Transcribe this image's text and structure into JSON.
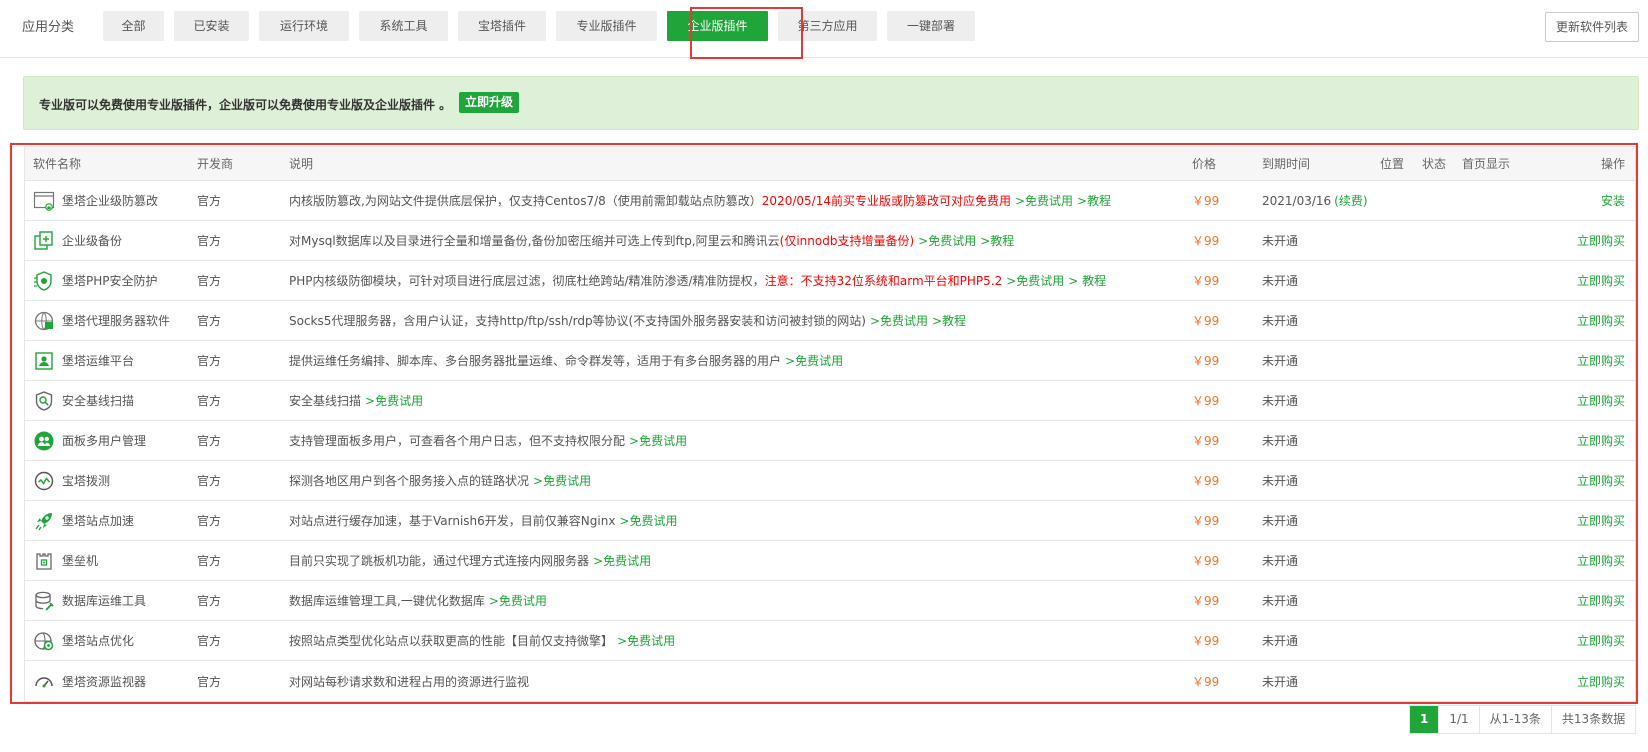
{
  "category": {
    "title": "应用分类",
    "tabs": [
      {
        "label": "全部"
      },
      {
        "label": "已安装"
      },
      {
        "label": "运行环境"
      },
      {
        "label": "系统工具"
      },
      {
        "label": "宝塔插件"
      },
      {
        "label": "专业版插件"
      },
      {
        "label": "企业版插件",
        "active": true
      },
      {
        "label": "第三方应用"
      },
      {
        "label": "一键部署"
      }
    ],
    "refresh_label": "更新软件列表"
  },
  "notice": {
    "text": "专业版可以免费使用专业版插件，企业版可以免费使用专业版及企业版插件 。",
    "upgrade_label": "立即升级"
  },
  "table": {
    "headers": {
      "name": "软件名称",
      "developer": "开发商",
      "desc": "说明",
      "price": "价格",
      "expire": "到期时间",
      "position": "位置",
      "status": "状态",
      "home": "首页显示",
      "action": "操作"
    },
    "rows": [
      {
        "icon": "tamper-proof-icon",
        "name": "堡塔企业级防篡改",
        "developer": "官方",
        "desc": "内核版防篡改,为网站文件提供底层保护，仅支持Centos7/8（使用前需卸载站点防篡改）",
        "desc_red": "2020/05/14前买专业版或防篡改可对应免费用",
        "links": [
          ">免费试用",
          ">教程"
        ],
        "price": "￥99",
        "expire": "2021/03/16",
        "expire_link": "(续费)",
        "action": "安装"
      },
      {
        "icon": "backup-icon",
        "name": "企业级备份",
        "developer": "官方",
        "desc": "对Mysql数据库以及目录进行全量和增量备份,备份加密压缩并可选上传到ftp,阿里云和腾讯云",
        "desc_red": "(仅innodb支持增量备份)",
        "links": [
          ">免费试用",
          ">教程"
        ],
        "price": "￥99",
        "expire": "未开通",
        "action": "立即购买"
      },
      {
        "icon": "php-shield-icon",
        "name": "堡塔PHP安全防护",
        "developer": "官方",
        "desc": "PHP内核级防御模块，可针对项目进行底层过滤，彻底杜绝跨站/精准防渗透/精准防提权，",
        "desc_red": "注意：不支持32位系统和arm平台和PHP5.2",
        "links": [
          ">免费试用",
          "> 教程"
        ],
        "price": "￥99",
        "expire": "未开通",
        "action": "立即购买"
      },
      {
        "icon": "proxy-server-icon",
        "name": "堡塔代理服务器软件",
        "developer": "官方",
        "desc": "Socks5代理服务器，含用户认证，支持http/ftp/ssh/rdp等协议(不支持国外服务器安装和访问被封锁的网站)",
        "desc_red": "",
        "links": [
          ">免费试用",
          ">教程"
        ],
        "price": "￥99",
        "expire": "未开通",
        "action": "立即购买"
      },
      {
        "icon": "ops-platform-icon",
        "name": "堡塔运维平台",
        "developer": "官方",
        "desc": "提供运维任务编排、脚本库、多台服务器批量运维、命令群发等，适用于有多台服务器的用户",
        "desc_red": "",
        "links": [
          ">免费试用"
        ],
        "price": "￥99",
        "expire": "未开通",
        "action": "立即购买"
      },
      {
        "icon": "baseline-scan-icon",
        "name": "安全基线扫描",
        "developer": "官方",
        "desc": "安全基线扫描",
        "desc_red": "",
        "links": [
          ">免费试用"
        ],
        "price": "￥99",
        "expire": "未开通",
        "action": "立即购买"
      },
      {
        "icon": "multi-user-icon",
        "name": "面板多用户管理",
        "developer": "官方",
        "desc": "支持管理面板多用户，可查看各个用户日志，但不支持权限分配",
        "desc_red": "",
        "links": [
          ">免费试用"
        ],
        "price": "￥99",
        "expire": "未开通",
        "action": "立即购买"
      },
      {
        "icon": "probe-icon",
        "name": "宝塔拨测",
        "developer": "官方",
        "desc": "探测各地区用户到各个服务接入点的链路状况",
        "desc_red": "",
        "links": [
          ">免费试用"
        ],
        "price": "￥99",
        "expire": "未开通",
        "action": "立即购买"
      },
      {
        "icon": "rocket-icon",
        "name": "堡塔站点加速",
        "developer": "官方",
        "desc": "对站点进行缓存加速，基于Varnish6开发，目前仅兼容Nginx",
        "desc_red": "",
        "links": [
          ">免费试用"
        ],
        "price": "￥99",
        "expire": "未开通",
        "action": "立即购买"
      },
      {
        "icon": "bastion-icon",
        "name": "堡垒机",
        "developer": "官方",
        "desc": "目前只实现了跳板机功能，通过代理方式连接内网服务器",
        "desc_red": "",
        "links": [
          ">免费试用"
        ],
        "price": "￥99",
        "expire": "未开通",
        "action": "立即购买"
      },
      {
        "icon": "database-tool-icon",
        "name": "数据库运维工具",
        "developer": "官方",
        "desc": "数据库运维管理工具,一键优化数据库",
        "desc_red": "",
        "links": [
          ">免费试用"
        ],
        "price": "￥99",
        "expire": "未开通",
        "action": "立即购买"
      },
      {
        "icon": "site-optimize-icon",
        "name": "堡塔站点优化",
        "developer": "官方",
        "desc": "按照站点类型优化站点以获取更高的性能【目前仅支持微擎】",
        "desc_red": "",
        "links": [
          ">免费试用"
        ],
        "price": "￥99",
        "expire": "未开通",
        "action": "立即购买"
      },
      {
        "icon": "gauge-icon",
        "name": "堡塔资源监视器",
        "developer": "官方",
        "desc": "对网站每秒请求数和进程占用的资源进行监视",
        "desc_red": "",
        "links": [],
        "price": "￥99",
        "expire": "未开通",
        "action": "立即购买"
      }
    ]
  },
  "pager": {
    "current": "1",
    "pages": "1/1",
    "range": "从1-13条",
    "total": "共13条数据"
  },
  "colors": {
    "accent": "#20a53a",
    "danger": "#ff0000",
    "price": "#f0742c",
    "highlight_frame": "#e53935"
  }
}
